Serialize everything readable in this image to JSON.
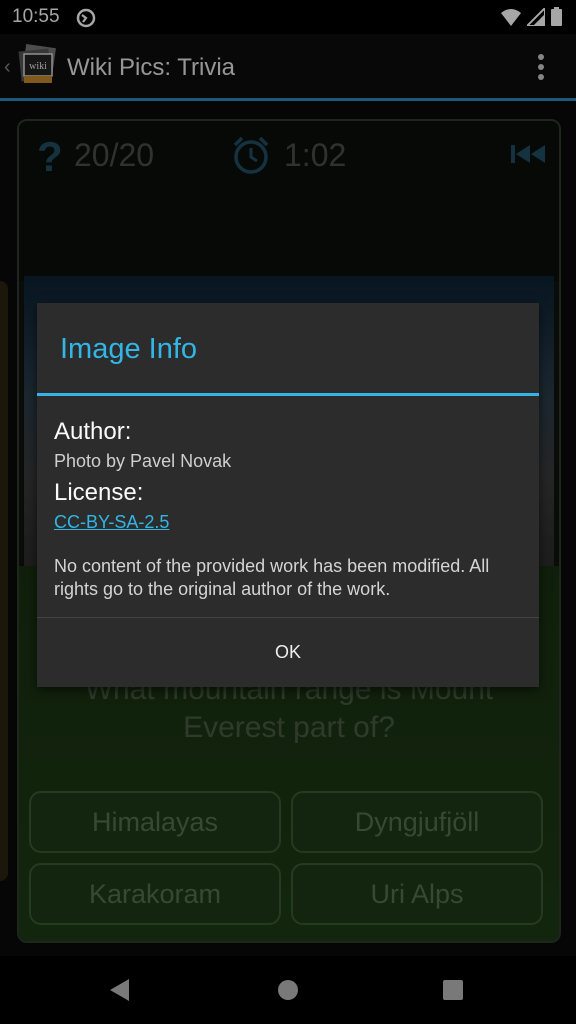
{
  "status": {
    "time": "10:55"
  },
  "app": {
    "title": "Wiki Pics: Trivia",
    "logo_text": "wiki"
  },
  "game": {
    "question_count": "20/20",
    "timer": "1:02",
    "question": "What mountain range is Mount Everest part of?",
    "answers": [
      "Himalayas",
      "Dyngjufjöll",
      "Karakoram",
      "Uri Alps"
    ]
  },
  "dialog": {
    "title": "Image Info",
    "author_label": "Author:",
    "author_value": "Photo by Pavel Novak",
    "license_label": "License:",
    "license_link": "CC-BY-SA-2.5",
    "note": "No content of the provided work has been modified. All rights go to the original author of the work.",
    "ok_label": "OK"
  },
  "colors": {
    "accent": "#33b5e5",
    "dialog_bg": "#2c2c2c",
    "answer_bg": "#1f3a17"
  }
}
